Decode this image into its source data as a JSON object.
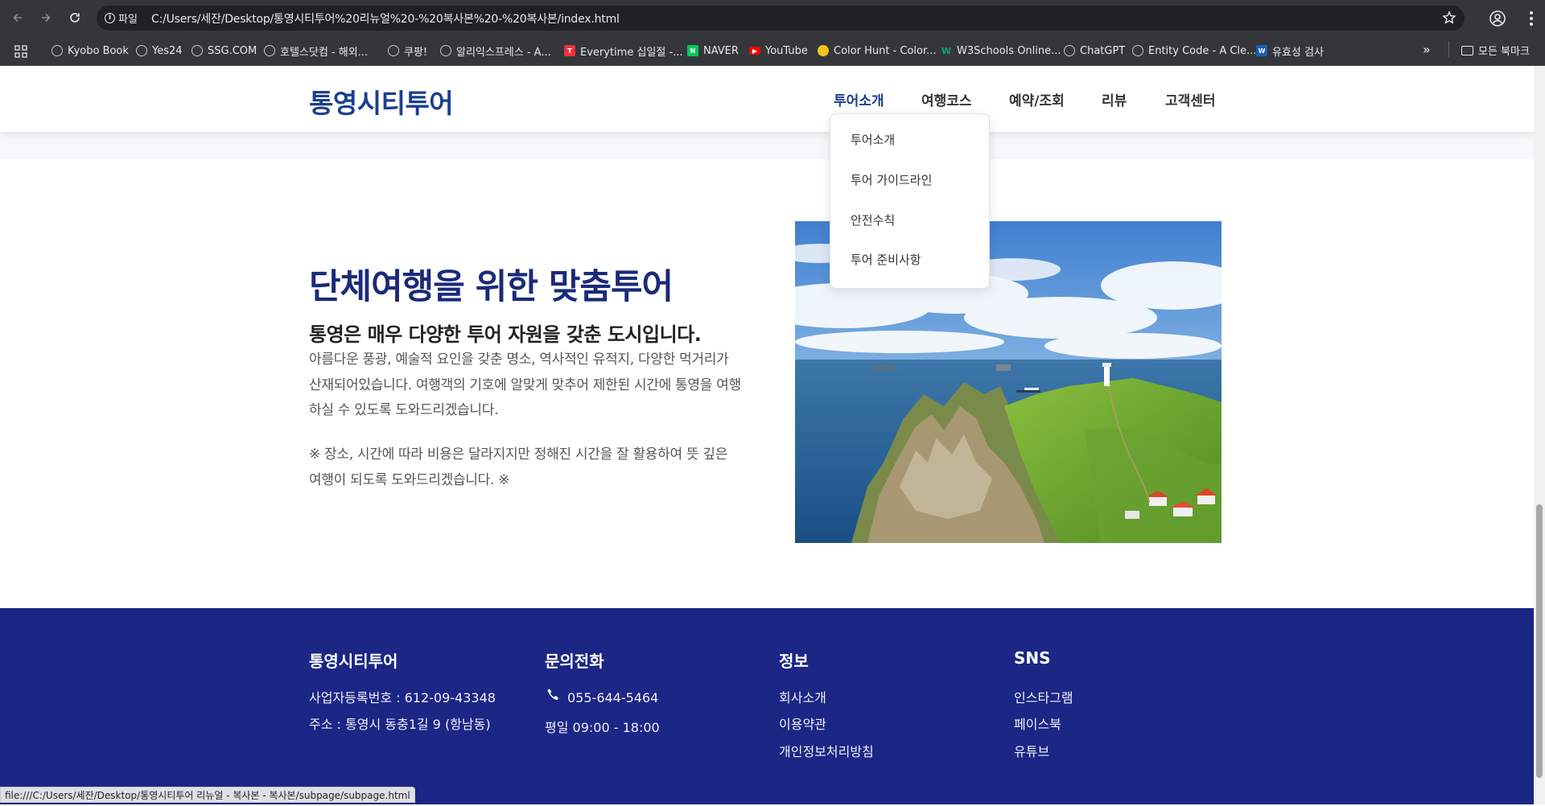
{
  "browser": {
    "site_chip": "파일",
    "url": "C:/Users/세잔/Desktop/통영시티투어%20리뉴얼%20-%20복사본%20-%20복사본/index.html",
    "bookmarks": [
      {
        "label": "Kyobo Book",
        "icon": "globe-icon",
        "color": "#c4c7c5"
      },
      {
        "label": "Yes24",
        "icon": "globe-icon",
        "color": "#c4c7c5"
      },
      {
        "label": "SSG.COM",
        "icon": "globe-icon",
        "color": "#c4c7c5"
      },
      {
        "label": "호텔스닷컴 - 해외...",
        "icon": "globe-icon",
        "color": "#c4c7c5"
      },
      {
        "label": "쿠팡!",
        "icon": "globe-icon",
        "color": "#c4c7c5"
      },
      {
        "label": "알리익스프레스 - A...",
        "icon": "globe-icon",
        "color": "#c4c7c5"
      },
      {
        "label": "Everytime 십일절 -...",
        "icon": "everytime-icon",
        "color": "#e8333b"
      },
      {
        "label": "NAVER",
        "icon": "naver-icon",
        "color": "#03c75a"
      },
      {
        "label": "YouTube",
        "icon": "youtube-icon",
        "color": "#ff0000"
      },
      {
        "label": "Color Hunt - Color...",
        "icon": "colorhunt-icon",
        "color": "#f5c518"
      },
      {
        "label": "W3Schools Online...",
        "icon": "w3schools-icon",
        "color": "#04aa6d"
      },
      {
        "label": "ChatGPT",
        "icon": "chatgpt-icon",
        "color": "#c4c7c5"
      },
      {
        "label": "Entity Code - A Cle...",
        "icon": "globe-icon",
        "color": "#c4c7c5"
      },
      {
        "label": "유효성 검사",
        "icon": "w3c-icon",
        "color": "#1a5fb4"
      }
    ],
    "more_bookmarks": "»",
    "all_bookmarks": "모든 북마크",
    "status_url": "file:///C:/Users/세잔/Desktop/통영시티투어 리뉴얼 - 복사본 - 복사본/subpage/subpage.html"
  },
  "header": {
    "logo": "통영시티투어",
    "nav": [
      "투어소개",
      "여행코스",
      "예약/조회",
      "리뷰",
      "고객센터"
    ],
    "active_index": 0,
    "dropdown": [
      "투어소개",
      "투어 가이드라인",
      "안전수칙",
      "투어 준비사항"
    ]
  },
  "hero": {
    "title": "단체여행을 위한 맞춤투어",
    "subtitle": "통영은 매우 다양한 투어 자원을 갖춘 도시입니다.",
    "body": "아름다운 풍광, 예술적 요인을 갖춘 명소, 역사적인 유적지, 다양한 먹거리가 산재되어있습니다. 여행객의 기호에 알맞게 맞추어 제한된 시간에 통영을 여행하실 수 있도록 도와드리겠습니다.",
    "note": "※ 장소, 시간에 따라 비용은 달라지지만 정해진 시간을 잘 활용하여 뜻 깊은 여행이 되도록 도와드리겠습니다. ※"
  },
  "footer": {
    "company": {
      "title": "통영시티투어",
      "lines": [
        "사업자등록번호 : 612-09-43348",
        "주소 : 통영시 동충1길 9 (항남동)"
      ]
    },
    "contact": {
      "title": "문의전화",
      "phone": "055-644-5464",
      "hours": "평일 09:00 - 18:00"
    },
    "info": {
      "title": "정보",
      "links": [
        "회사소개",
        "이용약관",
        "개인정보처리방침"
      ]
    },
    "sns": {
      "title": "SNS",
      "links": [
        "인스타그램",
        "페이스북",
        "유튜브"
      ]
    }
  },
  "colors": {
    "brand": "#1a3f8f",
    "title": "#1a2a7a",
    "footer_bg": "#1b2685",
    "chrome_bg": "#35363a"
  }
}
